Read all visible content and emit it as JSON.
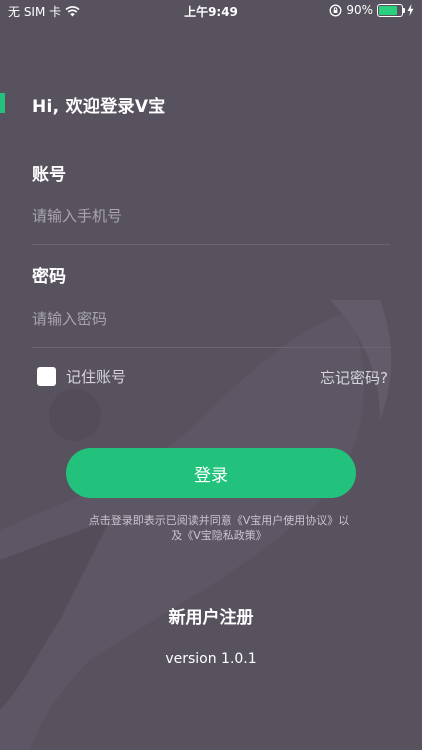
{
  "status_bar": {
    "carrier": "无 SIM 卡",
    "time": "上午9:49",
    "battery_percent": "90%",
    "battery_level": 0.9,
    "wifi_icon": "wifi-icon",
    "lock_icon": "orientation-lock-icon",
    "charging_icon": "charging-bolt-icon"
  },
  "welcome": "Hi,  欢迎登录V宝",
  "account": {
    "label": "账号",
    "placeholder": "请输入手机号",
    "value": ""
  },
  "password": {
    "label": "密码",
    "placeholder": "请输入密码",
    "value": ""
  },
  "remember": {
    "label": "记住账号",
    "checked": false
  },
  "forgot_password": "忘记密码?",
  "login_button": "登录",
  "agreement": {
    "prefix": "点击登录即表示已阅读并同意",
    "user_agreement": "《V宝用户使用协议》",
    "conjunction": "以及",
    "privacy_policy": "《V宝隐私政策》"
  },
  "register": "新用户注册",
  "version": "version 1.0.1",
  "colors": {
    "background": "#58525f",
    "accent": "#22c27d",
    "text": "#ffffff",
    "placeholder": "#a9a4b0",
    "divider": "#6b6572"
  }
}
